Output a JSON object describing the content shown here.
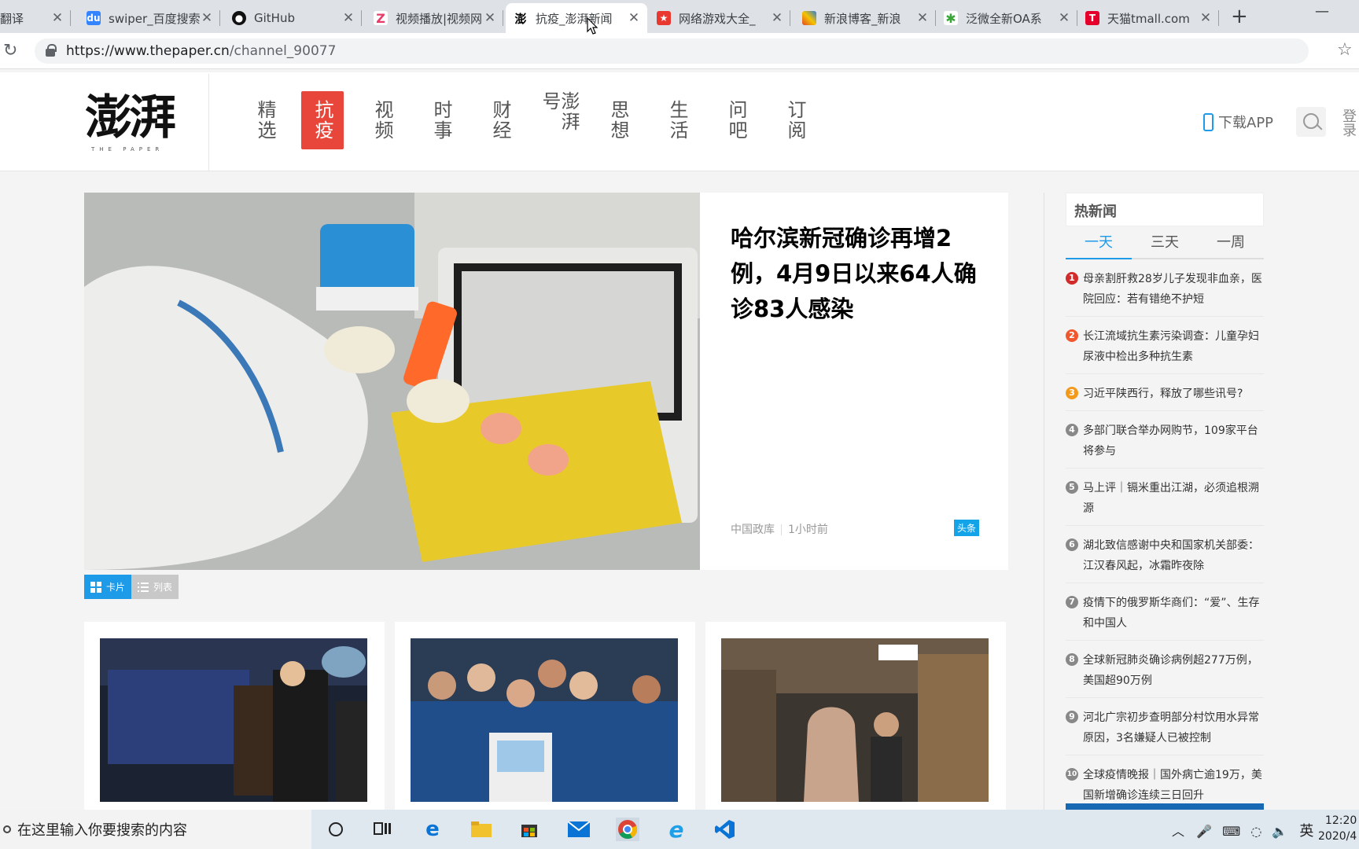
{
  "browser": {
    "tabs": [
      {
        "title": "翻译",
        "favicon": "",
        "color": "#4285f4"
      },
      {
        "title": "swiper_百度搜索",
        "favicon": "du",
        "color": "#3385ff"
      },
      {
        "title": "GitHub",
        "favicon": "gh",
        "color": "#000000"
      },
      {
        "title": "视频播放|视频网",
        "favicon": "Z",
        "color": "#ffffff"
      },
      {
        "title": "抗疫_澎湃新闻",
        "favicon": "澎",
        "color": "#ffffff"
      },
      {
        "title": "网络游戏大全_",
        "favicon": "★",
        "color": "#e8382f"
      },
      {
        "title": "新浪博客_新浪",
        "favicon": "■",
        "color": "#e04a26"
      },
      {
        "title": "泛微全新OA系",
        "favicon": "✱",
        "color": "#3aa63a"
      },
      {
        "title": "天猫tmall.com",
        "favicon": "T",
        "color": "#e4002b"
      }
    ],
    "new_tab": "+",
    "url_host": "https://www.thepaper.cn",
    "url_path": "/channel_90077"
  },
  "site": {
    "logo": "澎湃",
    "logo_sub": "THE PAPER",
    "nav": [
      "精选",
      "抗疫",
      "视频",
      "时事",
      "财经",
      "澎湃号",
      "思想",
      "生活",
      "问吧",
      "订阅"
    ],
    "nav_active": "抗疫",
    "download_app": "下载APP",
    "login": "登录"
  },
  "hero": {
    "title": "哈尔滨新冠确诊再增2例，4月9日以来64人确诊83人感染",
    "source": "中国政库",
    "time": "1小时前",
    "tag": "头条",
    "tag_color": "#13a3e8"
  },
  "view_switch": {
    "card": "卡片",
    "list": "列表"
  },
  "hot_news": {
    "title": "热新闻",
    "tabs": [
      "一天",
      "三天",
      "一周"
    ],
    "active_tab": "一天",
    "items": [
      {
        "num": "1",
        "text": "母亲割肝救28岁儿子发现非血亲，医院回应：若有错绝不护短",
        "color": "#d22b2b"
      },
      {
        "num": "2",
        "text": "长江流域抗生素污染调查：儿童孕妇尿液中检出多种抗生素",
        "color": "#f0572c"
      },
      {
        "num": "3",
        "text": "习近平陕西行，释放了哪些讯号?",
        "color": "#f39a1b"
      },
      {
        "num": "4",
        "text": "多部门联合举办网购节，109家平台将参与",
        "color": "#888888"
      },
      {
        "num": "5",
        "text": "马上评｜镉米重出江湖，必须追根溯源",
        "color": "#888888"
      },
      {
        "num": "6",
        "text": "湖北致信感谢中央和国家机关部委：江汉春风起，冰霜昨夜除",
        "color": "#888888"
      },
      {
        "num": "7",
        "text": "疫情下的俄罗斯华商们：“爱”、生存和中国人",
        "color": "#888888"
      },
      {
        "num": "8",
        "text": "全球新冠肺炎确诊病例超277万例，美国超90万例",
        "color": "#888888"
      },
      {
        "num": "9",
        "text": "河北广宗初步查明部分村饮用水异常原因，3名嫌疑人已被控制",
        "color": "#888888"
      },
      {
        "num": "10",
        "text": "全球疫情晚报｜国外病亡逾19万，美国新增确诊连续三日回升",
        "color": "#888888"
      }
    ]
  },
  "taskbar": {
    "search_placeholder": "在这里输入你要搜索的内容",
    "ime": "英",
    "time": "12:20",
    "date": "2020/4"
  }
}
